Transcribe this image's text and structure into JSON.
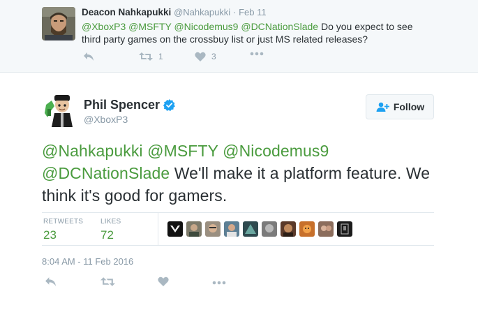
{
  "reply_tweet": {
    "name": "Deacon Nahkapukki",
    "handle": "@Nahkapukki",
    "separator": "·",
    "time": "Feb 11",
    "text_parts": {
      "mention1": "@XboxP3",
      "mention2": "@MSFTY",
      "mention3": "@Nicodemus9",
      "mention4": "@DCNationSlade",
      "body": "Do you expect to see third party games on the crossbuy list or just MS related releases?"
    },
    "retweet_count": "1",
    "like_count": "3",
    "icons": [
      "reply-icon",
      "retweet-icon",
      "heart-icon",
      "more-icon"
    ]
  },
  "main_tweet": {
    "name": "Phil Spencer",
    "handle": "@XboxP3",
    "follow_label": "Follow",
    "text_parts": {
      "mention1": "@Nahkapukki",
      "mention2": "@MSFTY",
      "mention3": "@Nicodemus9",
      "mention4": "@DCNationSlade",
      "body": "We'll make it a platform feature. We think it's good for gamers."
    },
    "stats": {
      "retweets_label": "RETWEETS",
      "retweets_value": "23",
      "likes_label": "LIKES",
      "likes_value": "72"
    },
    "timestamp": "8:04 AM - 11 Feb 2016",
    "icons": [
      "reply-icon",
      "retweet-icon",
      "heart-icon",
      "more-icon",
      "verified-badge-icon",
      "follow-person-icon"
    ]
  },
  "colors": {
    "mention_green": "#4a9b3e",
    "muted_gray": "#8899a6",
    "verified_blue": "#1da1f2",
    "parent_bg": "#f5f8fa"
  }
}
